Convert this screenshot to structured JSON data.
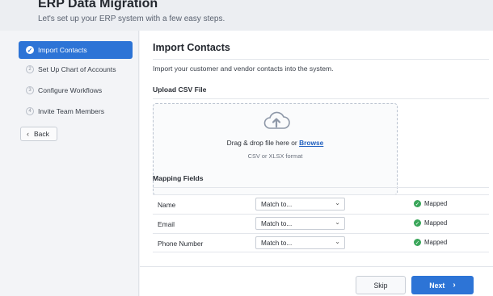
{
  "header": {
    "title": "ERP Data Migration",
    "subtitle": "Let's set up your ERP system with a few easy steps."
  },
  "sidebar": {
    "steps": [
      {
        "num": "✓",
        "label": "Import Contacts",
        "active": true
      },
      {
        "num": "2",
        "label": "Set Up Chart of Accounts",
        "active": false
      },
      {
        "num": "3",
        "label": "Configure Workflows",
        "active": false
      },
      {
        "num": "4",
        "label": "Invite Team Members",
        "active": false
      }
    ],
    "back_label": "Back",
    "back_icon": "‹"
  },
  "main": {
    "title": "Import Contacts",
    "description": "Import your customer and vendor contacts into the system.",
    "upload": {
      "section_title": "Upload CSV File",
      "drag_text": "Drag & drop file here or ",
      "browse_label": "Browse",
      "format_hint": "CSV or XLSX format"
    },
    "mapping": {
      "section_title": "Mapping Fields",
      "rows": [
        {
          "field": "Name",
          "select_value": "Match to...",
          "status": "Mapped"
        },
        {
          "field": "Email",
          "select_value": "Match to...",
          "status": "Mapped"
        },
        {
          "field": "Phone Number",
          "select_value": "Match to...",
          "status": "Mapped"
        }
      ]
    }
  },
  "footer": {
    "skip_label": "Skip",
    "next_label": "Next",
    "next_icon": "›"
  },
  "colors": {
    "accent": "#2d74d6",
    "success": "#3aa65a",
    "link": "#1f5fbf"
  },
  "icons": {
    "upload": "cloud-upload-icon",
    "check": "check-circle-icon",
    "dropdown": "chevron-down-icon"
  }
}
